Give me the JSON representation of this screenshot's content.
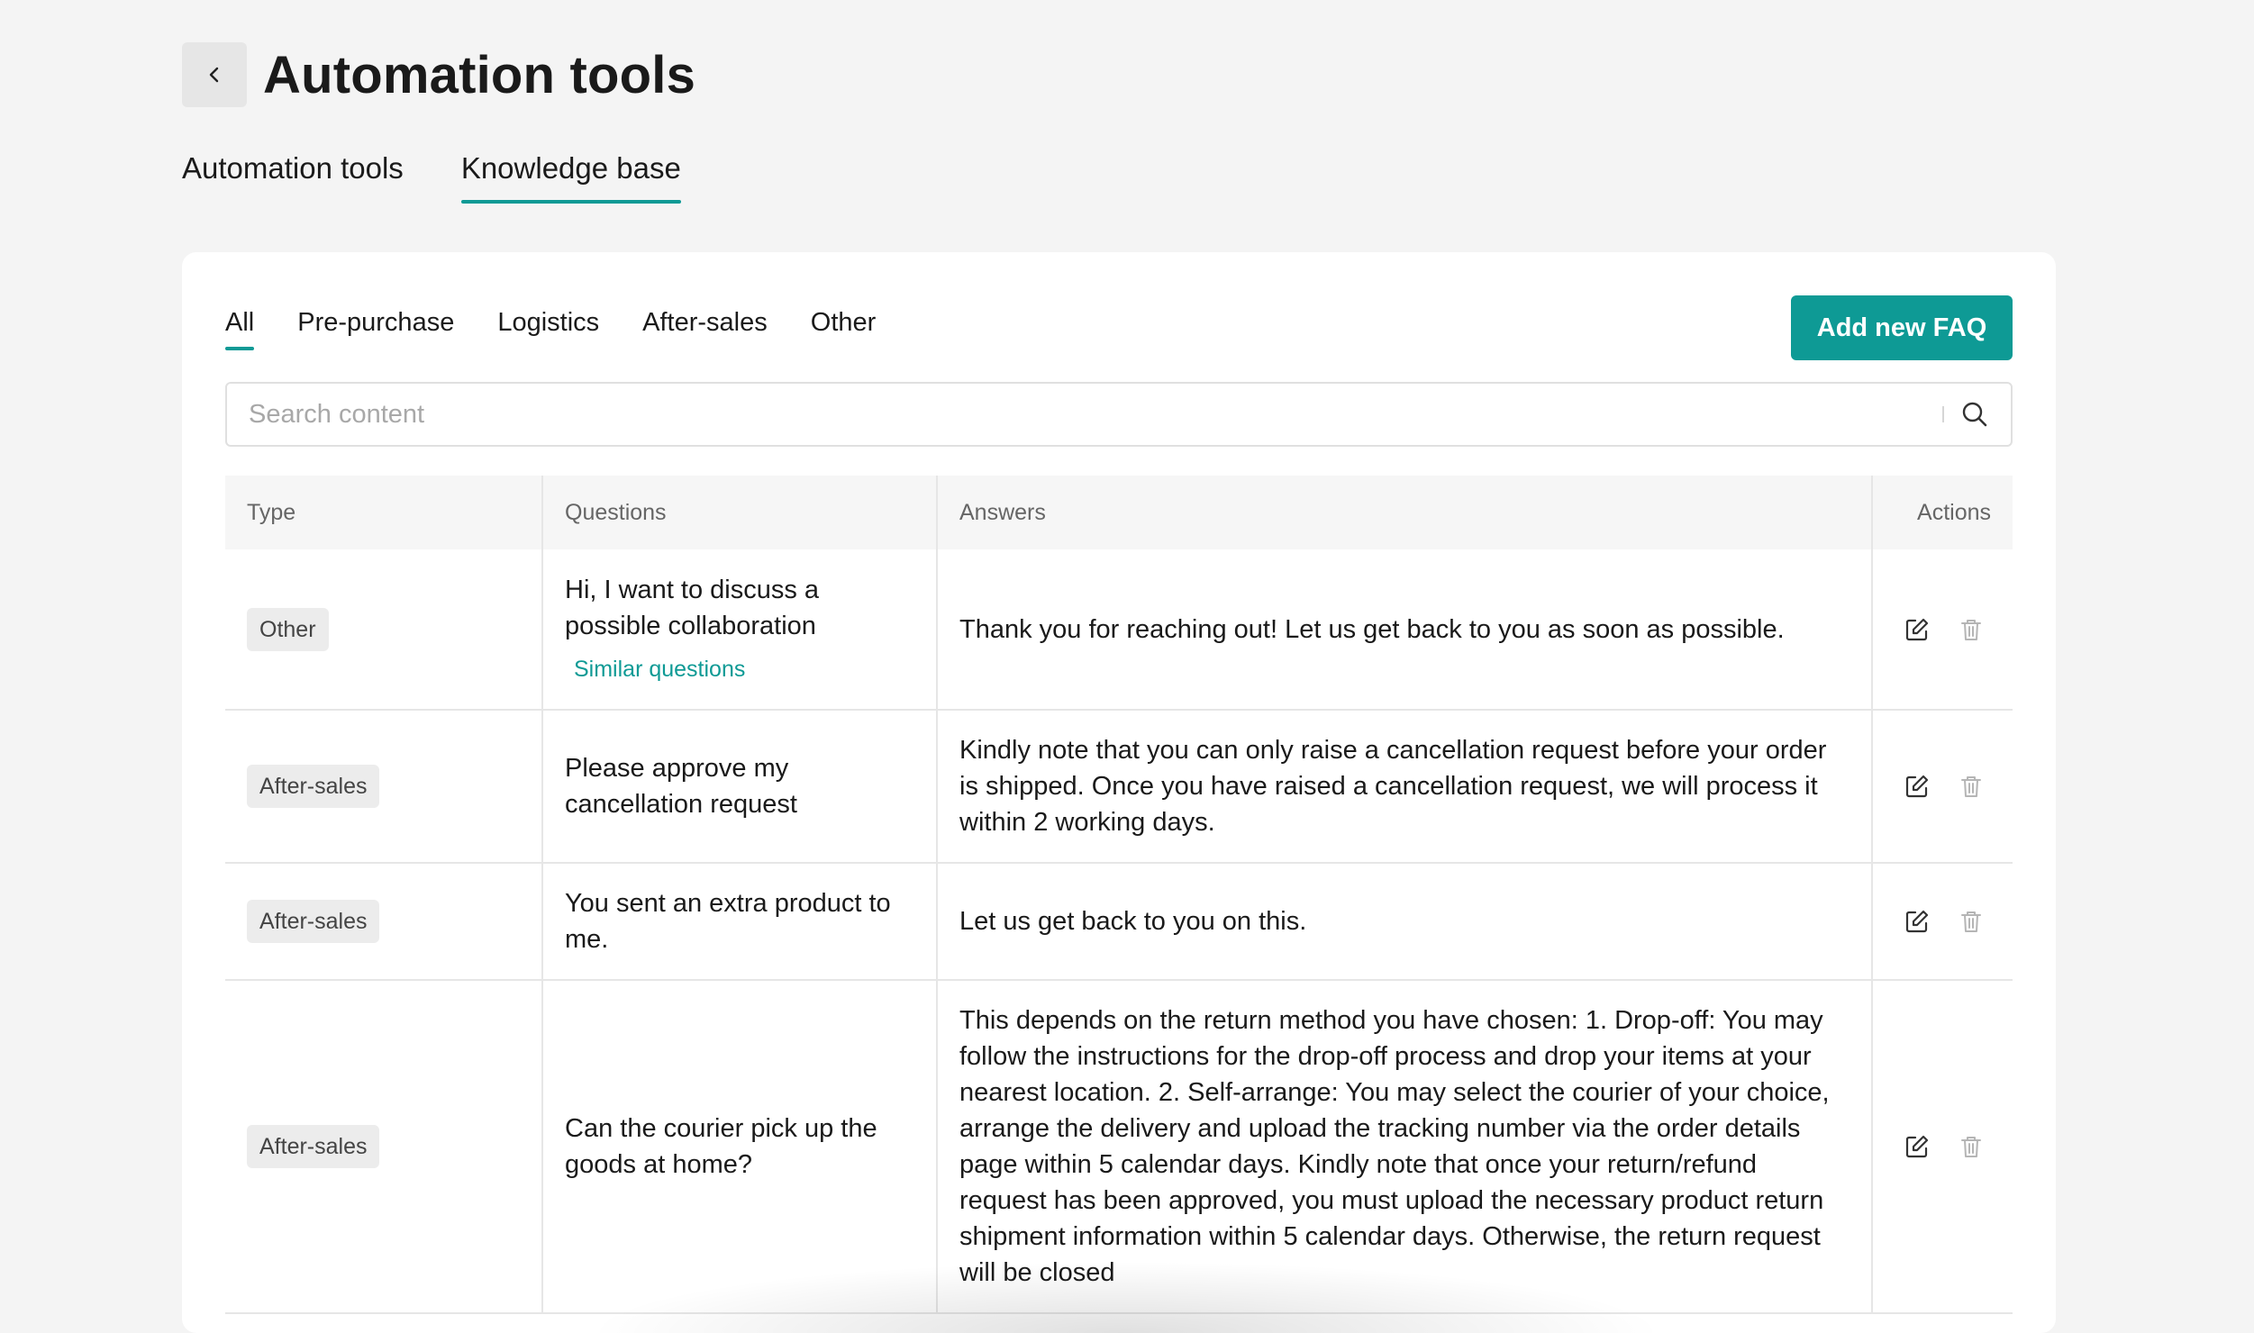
{
  "header": {
    "title": "Automation tools"
  },
  "main_tabs": [
    {
      "label": "Automation tools",
      "active": false
    },
    {
      "label": "Knowledge base",
      "active": true
    }
  ],
  "filter_tabs": [
    {
      "label": "All",
      "active": true
    },
    {
      "label": "Pre-purchase",
      "active": false
    },
    {
      "label": "Logistics",
      "active": false
    },
    {
      "label": "After-sales",
      "active": false
    },
    {
      "label": "Other",
      "active": false
    }
  ],
  "add_button": {
    "label": "Add new FAQ"
  },
  "search": {
    "placeholder": "Search content",
    "value": ""
  },
  "table": {
    "columns": [
      "Type",
      "Questions",
      "Answers",
      "Actions"
    ],
    "rows": [
      {
        "type": "Other",
        "question": "Hi, I want to discuss a possible collaboration",
        "similar_link": "Similar questions",
        "answer": "Thank you for reaching out! Let us get back to you as soon as possible."
      },
      {
        "type": "After-sales",
        "question": "Please approve my cancellation request",
        "answer": "Kindly note that you can only raise a cancellation request before your order is shipped. Once you have raised a cancellation request, we will process it within 2 working days."
      },
      {
        "type": "After-sales",
        "question": "You sent an extra product to me.",
        "answer": "Let us get back to you on this."
      },
      {
        "type": "After-sales",
        "question": "Can the courier pick up the goods at home?",
        "answer": "This depends on the return method you have chosen: 1. Drop-off: You may follow the instructions for the drop-off process and drop your items at your nearest location. 2. Self-arrange: You may select the courier of your choice, arrange the delivery and upload the tracking number via the order details page within 5 calendar days. Kindly note that once your return/refund request has been approved, you must upload the necessary product return shipment information within 5 calendar days. Otherwise, the return request will be closed"
      }
    ]
  },
  "colors": {
    "accent": "#0e9a95",
    "background": "#f4f4f4",
    "card": "#ffffff"
  },
  "icons": [
    "chevron-left-icon",
    "search-icon",
    "edit-icon",
    "trash-icon"
  ]
}
